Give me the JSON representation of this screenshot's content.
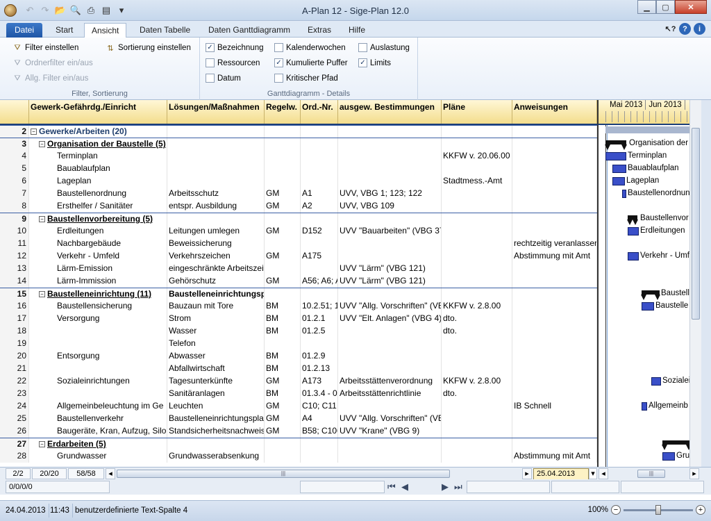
{
  "window": {
    "title": "A-Plan 12 - Sige-Plan 12.0"
  },
  "quick_access": [
    "undo-icon",
    "redo-icon",
    "open-icon",
    "preview-icon",
    "print-icon",
    "page-icon",
    "dropdown-icon"
  ],
  "tabs": [
    {
      "label": "Datei"
    },
    {
      "label": "Start"
    },
    {
      "label": "Ansicht"
    },
    {
      "label": "Daten Tabelle"
    },
    {
      "label": "Daten Ganttdiagramm"
    },
    {
      "label": "Extras"
    },
    {
      "label": "Hilfe"
    }
  ],
  "ribbon": {
    "filter": {
      "filter_einstellen": "Filter einstellen",
      "ordnerfilter": "Ordnerfilter ein/aus",
      "allg_filter": "Allg. Filter ein/aus",
      "sortierung": "Sortierung einstellen",
      "group_label": "Filter, Sortierung"
    },
    "gantt": {
      "bezeichnung": "Bezeichnung",
      "ressourcen": "Ressourcen",
      "datum": "Datum",
      "kalenderwochen": "Kalenderwochen",
      "kumulierte_puffer": "Kumulierte Puffer",
      "kritischer_pfad": "Kritischer Pfad",
      "auslastung": "Auslastung",
      "limits": "Limits",
      "group_label": "Ganttdiagramm - Details",
      "check_mark": "✓",
      "checked": {
        "bezeichnung": true,
        "ressourcen": false,
        "datum": false,
        "kalenderwochen": false,
        "kumulierte_puffer": true,
        "kritischer_pfad": false,
        "auslastung": false,
        "limits": true
      }
    }
  },
  "table": {
    "columns": [
      "Gewerk-Gefährdg./Einricht",
      "Lösungen/Maßnahmen",
      "Regelw.",
      "Ord.-Nr.",
      "ausgew. Bestimmungen",
      "Pläne",
      "Anweisungen"
    ],
    "rows": [
      {
        "n": "2",
        "level": 1,
        "name": "Gewerke/Arbeiten (20)",
        "loes": "",
        "reg": "",
        "ord": "",
        "best": "",
        "plan": "",
        "anw": ""
      },
      {
        "n": "3",
        "level": 2,
        "name": "Organisation der Baustelle (5)",
        "loes": "",
        "reg": "",
        "ord": "",
        "best": "",
        "plan": "",
        "anw": ""
      },
      {
        "n": "4",
        "level": 3,
        "name": "Terminplan",
        "loes": "",
        "reg": "",
        "ord": "",
        "best": "",
        "plan": "KKFW v. 20.06.00",
        "anw": ""
      },
      {
        "n": "5",
        "level": 3,
        "name": "Bauablaufplan",
        "loes": "",
        "reg": "",
        "ord": "",
        "best": "",
        "plan": "",
        "anw": ""
      },
      {
        "n": "6",
        "level": 3,
        "name": "Lageplan",
        "loes": "",
        "reg": "",
        "ord": "",
        "best": "",
        "plan": "Stadtmess.-Amt",
        "anw": ""
      },
      {
        "n": "7",
        "level": 3,
        "name": "Baustellenordnung",
        "loes": "Arbeitsschutz",
        "reg": "GM",
        "ord": "A1",
        "best": "UVV, VBG 1; 123; 122",
        "plan": "",
        "anw": ""
      },
      {
        "n": "8",
        "level": 3,
        "name": "Ersthelfer / Sanitäter",
        "loes": "entspr. Ausbildung",
        "reg": "GM",
        "ord": "A2",
        "best": "UVV, VBG 109",
        "plan": "",
        "anw": ""
      },
      {
        "n": "9",
        "level": 2,
        "name": "Baustellenvorbereitung (5)",
        "loes": "",
        "reg": "",
        "ord": "",
        "best": "",
        "plan": "",
        "anw": ""
      },
      {
        "n": "10",
        "level": 3,
        "name": "Erdleitungen",
        "loes": "Leitungen umlegen",
        "reg": "GM",
        "ord": "D152",
        "best": "UVV \"Bauarbeiten\" (VBG 37",
        "plan": "",
        "anw": ""
      },
      {
        "n": "11",
        "level": 3,
        "name": "Nachbargebäude",
        "loes": "Beweissicherung",
        "reg": "",
        "ord": "",
        "best": "",
        "plan": "",
        "anw": "rechtzeitig veranlasser"
      },
      {
        "n": "12",
        "level": 3,
        "name": "Verkehr - Umfeld",
        "loes": "Verkehrszeichen",
        "reg": "GM",
        "ord": "A175",
        "best": "",
        "plan": "",
        "anw": "Abstimmung mit Amt"
      },
      {
        "n": "13",
        "level": 3,
        "name": "Lärm-Emission",
        "loes": "eingeschränkte Arbeitszeit",
        "reg": "",
        "ord": "",
        "best": "UVV \"Lärm\" (VBG 121)",
        "plan": "",
        "anw": ""
      },
      {
        "n": "14",
        "level": 3,
        "name": "Lärm-Immission",
        "loes": "Gehörschutz",
        "reg": "GM",
        "ord": "A56; A6; A",
        "best": "UVV \"Lärm\" (VBG 121)",
        "plan": "",
        "anw": ""
      },
      {
        "n": "15",
        "level": 2,
        "name": "Baustelleneinrichtung (11)",
        "loes": "Baustelleneinrichtungspl",
        "reg": "",
        "ord": "",
        "best": "",
        "plan": "",
        "anw": ""
      },
      {
        "n": "16",
        "level": 3,
        "name": "Baustellensicherung",
        "loes": "Bauzaun mit Tore",
        "reg": "BM",
        "ord": "10.2.51; 1",
        "best": "UVV \"Allg. Vorschriften\" (VE",
        "plan": "KKFW v. 2.8.00",
        "anw": ""
      },
      {
        "n": "17",
        "level": 3,
        "name": "Versorgung",
        "loes": "Strom",
        "reg": "BM",
        "ord": "01.2.1",
        "best": "UVV \"Elt. Anlagen\" (VBG 4)",
        "plan": "dto.",
        "anw": ""
      },
      {
        "n": "18",
        "level": 3,
        "name": "",
        "loes": "Wasser",
        "reg": "BM",
        "ord": "01.2.5",
        "best": "",
        "plan": "dto.",
        "anw": ""
      },
      {
        "n": "19",
        "level": 3,
        "name": "",
        "loes": "Telefon",
        "reg": "",
        "ord": "",
        "best": "",
        "plan": "",
        "anw": ""
      },
      {
        "n": "20",
        "level": 3,
        "name": "Entsorgung",
        "loes": "Abwasser",
        "reg": "BM",
        "ord": "01.2.9",
        "best": "",
        "plan": "",
        "anw": ""
      },
      {
        "n": "21",
        "level": 3,
        "name": "",
        "loes": "Abfallwirtschaft",
        "reg": "BM",
        "ord": "01.2.13",
        "best": "",
        "plan": "",
        "anw": ""
      },
      {
        "n": "22",
        "level": 3,
        "name": "Sozialeinrichtungen",
        "loes": "Tagesunterkünfte",
        "reg": "GM",
        "ord": "A173",
        "best": "Arbeitsstättenverordnung",
        "plan": "KKFW v. 2.8.00",
        "anw": ""
      },
      {
        "n": "23",
        "level": 3,
        "name": "",
        "loes": "Sanitäranlagen",
        "reg": "BM",
        "ord": "01.3.4 - 0",
        "best": "Arbeitsstättenrichtlinie",
        "plan": "dto.",
        "anw": ""
      },
      {
        "n": "24",
        "level": 3,
        "name": "Allgemeinbeleuchtung im Ge",
        "loes": "Leuchten",
        "reg": "GM",
        "ord": "C10; C11",
        "best": "",
        "plan": "",
        "anw": "IB Schnell"
      },
      {
        "n": "25",
        "level": 3,
        "name": "Baustellenverkehr",
        "loes": "Baustelleneinrichtungspla",
        "reg": "GM",
        "ord": "A4",
        "best": "UVV \"Allg. Vorschriften\" (VE",
        "plan": "",
        "anw": ""
      },
      {
        "n": "26",
        "level": 3,
        "name": "Baugeräte, Kran, Aufzug, Silo",
        "loes": "Standsicherheitsnachweis",
        "reg": "GM",
        "ord": "B58; C106",
        "best": "UVV \"Krane\" (VBG 9)",
        "plan": "",
        "anw": ""
      },
      {
        "n": "27",
        "level": 2,
        "name": "Erdarbeiten (5)",
        "loes": "",
        "reg": "",
        "ord": "",
        "best": "",
        "plan": "",
        "anw": ""
      },
      {
        "n": "28",
        "level": 3,
        "name": "Grundwasser",
        "loes": "Grundwasserabsenkung",
        "reg": "",
        "ord": "",
        "best": "",
        "plan": "",
        "anw": "Abstimmung mit Amt"
      }
    ]
  },
  "gantt": {
    "months": [
      "Mai 2013",
      "Jun 2013"
    ],
    "labels": {
      "r3": "Organisation der",
      "r4": "Terminplan",
      "r5": "Bauablaufplan",
      "r6": "Lageplan",
      "r7": "Baustellenordnun",
      "r9": "Baustellenvor",
      "r10": "Erdleitungen",
      "r12": "Verkehr - Umf",
      "r15": "Baustell",
      "r16": "Baustelle",
      "r22": "Sozialei",
      "r24": "Allgemeinb",
      "r28": "Gru"
    }
  },
  "nav": {
    "counter1": "2/2",
    "counter2": "20/20",
    "counter3": "58/58",
    "date": "25.04.2013",
    "record": "0/0/0/0",
    "first": "⏮",
    "prev": "◀",
    "next": "▶",
    "last": "⏭"
  },
  "status": {
    "date": "24.04.2013",
    "time": "11:43",
    "text": "benutzerdefinierte Text-Spalte 4",
    "zoom": "100%"
  }
}
